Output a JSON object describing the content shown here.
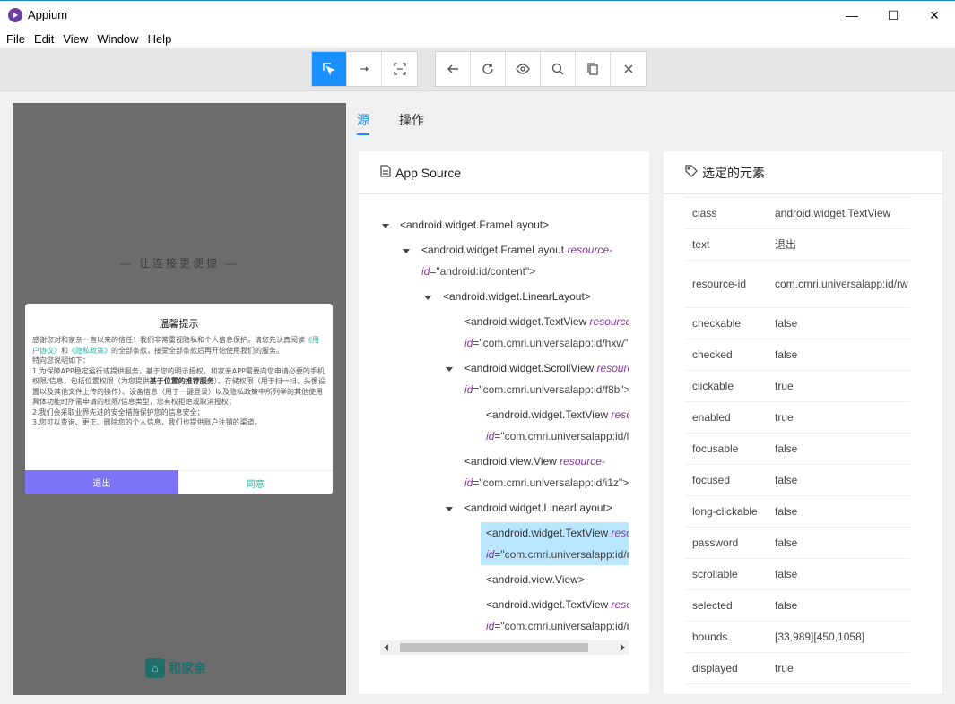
{
  "window": {
    "title": "Appium",
    "controls": [
      "—",
      "☐",
      "✕"
    ]
  },
  "menu": [
    "File",
    "Edit",
    "View",
    "Window",
    "Help"
  ],
  "toolbar": {
    "group1": [
      "select-element-icon",
      "swipe-icon",
      "tap-coordinates-icon"
    ],
    "group2": [
      "back-icon",
      "refresh-icon",
      "eye-icon",
      "search-icon",
      "copy-icon",
      "close-icon"
    ]
  },
  "device": {
    "slogan": "— 让连接更便捷 —",
    "dialog": {
      "title": "温馨提示",
      "p1_a": "感谢您对和家亲一直以来的信任！我们非常重视隐私和个人信息保护。请您先认真阅读",
      "p1_link1": "《用户协议》",
      "p1_b": "和",
      "p1_link2": "《隐私政策》",
      "p1_c": "的全部条款，接受全部条款后再开始使用我们的服务。",
      "p2": "特向您说明如下：",
      "p3_a": "1.为保障APP稳定运行或提供服务，基于您的明示授权，和家亲APP需要向您申请必要的手机权限/信息，包括位置权限（为您提供",
      "p3_bold": "基于位置的推荐服务",
      "p3_b": "）、存储权限（用于扫一扫、头像设置以及其他文件上传的操作）、设备信息（用于一键登录）以及隐私政策中所列举的其他使用具体功能时所需申请的权限/信息类型，您有权拒绝或取消授权；",
      "p4": "2.我们会采取业界先进的安全措施保护您的信息安全；",
      "p5": "3.您可以查询、更正、删除您的个人信息，我们也提供账户注销的渠道。",
      "exit": "退出",
      "agree": "同意"
    },
    "logo": "和家亲"
  },
  "tabs": [
    "源",
    "操作"
  ],
  "source": {
    "title": "App Source",
    "nodes": [
      {
        "tag": "<android.widget.FrameLayout>",
        "attr": "",
        "val": ""
      },
      {
        "tag": "<android.widget.FrameLayout ",
        "attr": "resource-",
        "line2a": "id",
        "line2b": "=\"android:id/content\">"
      },
      {
        "tag": "<android.widget.LinearLayout>",
        "attr": "",
        "val": ""
      },
      {
        "tag": "<android.widget.TextView ",
        "attr": "resource",
        "line2a": "id",
        "line2b": "=\"com.cmri.universalapp:id/hxw\""
      },
      {
        "tag": "<android.widget.ScrollView ",
        "attr": "resourc",
        "line2a": "id",
        "line2b": "=\"com.cmri.universalapp:id/f8b\">"
      },
      {
        "tag": "<android.widget.TextView ",
        "attr": "reso",
        "line2a": "id",
        "line2b": "=\"com.cmri.universalapp:id/l"
      },
      {
        "tag": "<android.view.View ",
        "attr": "resource-",
        "line2a": "id",
        "line2b": "=\"com.cmri.universalapp:id/i1z\">"
      },
      {
        "tag": "<android.widget.LinearLayout>",
        "attr": "",
        "val": ""
      },
      {
        "tag": "<android.widget.TextView ",
        "attr": "reso",
        "line2a": "id",
        "line2b": "=\"com.cmri.universalapp:id/r"
      },
      {
        "tag": "<android.view.View>",
        "attr": "",
        "val": ""
      },
      {
        "tag": "<android.widget.TextView ",
        "attr": "reso",
        "line2a": "id",
        "line2b": "=\"com.cmri.universalapp:id/r"
      }
    ]
  },
  "selected": {
    "title": "选定的元素",
    "props": [
      {
        "k": "class",
        "v": "android.widget.TextView"
      },
      {
        "k": "text",
        "v": "退出"
      },
      {
        "k": "resource-id",
        "v": "com.cmri.universalapp:id/rw"
      },
      {
        "k": "checkable",
        "v": "false"
      },
      {
        "k": "checked",
        "v": "false"
      },
      {
        "k": "clickable",
        "v": "true"
      },
      {
        "k": "enabled",
        "v": "true"
      },
      {
        "k": "focusable",
        "v": "false"
      },
      {
        "k": "focused",
        "v": "false"
      },
      {
        "k": "long-clickable",
        "v": "false"
      },
      {
        "k": "password",
        "v": "false"
      },
      {
        "k": "scrollable",
        "v": "false"
      },
      {
        "k": "selected",
        "v": "false"
      },
      {
        "k": "bounds",
        "v": "[33,989][450,1058]"
      },
      {
        "k": "displayed",
        "v": "true"
      }
    ]
  }
}
